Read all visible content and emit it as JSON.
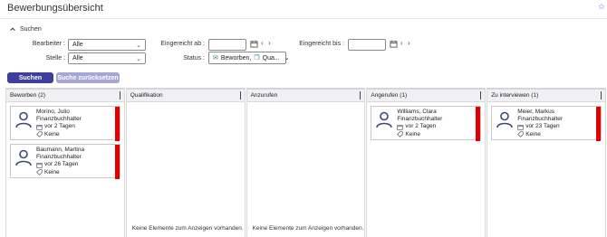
{
  "page": {
    "title": "Bewerbungsübersicht"
  },
  "search": {
    "toggle_label": "Suchen",
    "bearbeiter_label": "Bearbeiter :",
    "bearbeiter_value": "Alle",
    "stelle_label": "Stelle :",
    "stelle_value": "Alle",
    "eingereicht_ab_label": "Eingereicht ab :",
    "eingereicht_bis_label": "Eingereicht bis :",
    "status_label": "Status :",
    "status_value_1": "Beworben,",
    "status_value_2": "Qua...",
    "search_button": "Suchen",
    "reset_button": "Suche zurücksetzen"
  },
  "columns": [
    {
      "title": "Beworben (2)",
      "empty_text": ""
    },
    {
      "title": "Qualifikation",
      "empty_text": "Keine Elemente zum Anzeigen vorhanden."
    },
    {
      "title": "Anzurufen",
      "empty_text": "Keine Elemente zum Anzeigen vorhanden."
    },
    {
      "title": "Angerufen (1)",
      "empty_text": ""
    },
    {
      "title": "Zu interviewen (1)",
      "empty_text": ""
    }
  ],
  "cards": {
    "c1": {
      "name": "Morino, Julio",
      "position": "Finanzbuchhalter",
      "date": "vor 2 Tagen",
      "tag": "Keine"
    },
    "c2": {
      "name": "Baumann, Martina",
      "position": "Finanzbuchhalter",
      "date": "vor 26 Tagen",
      "tag": "Keine"
    },
    "c3": {
      "name": "Williams, Clara",
      "position": "Finanzbuchhalter",
      "date": "vor 2 Tagen",
      "tag": "Keine"
    },
    "c4": {
      "name": "Meier, Markus",
      "position": "Finanzbuchhalter",
      "date": "vor 23 Tagen",
      "tag": "Keine"
    }
  },
  "colors": {
    "primary": "#3e3f9c",
    "secondary": "#a6a6d4",
    "flag": "#e00000",
    "avatar": "#3a4a72"
  }
}
